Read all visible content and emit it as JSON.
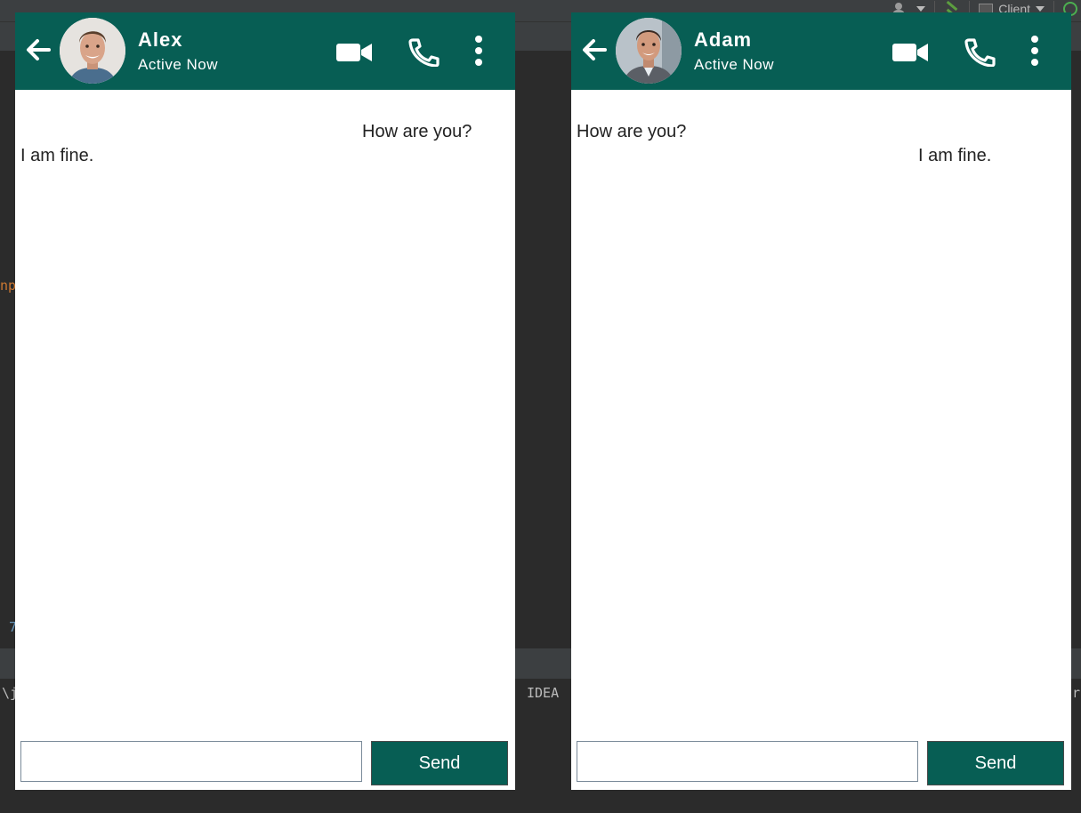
{
  "ide": {
    "client_label": "Client",
    "code_fragment_1": "np'",
    "code_fragment_2": "7",
    "console_left": "\\j",
    "console_mid": "IDEA",
    "console_right": "ra"
  },
  "left_chat": {
    "contact_name": "Alex",
    "status": "Active Now",
    "messages": [
      {
        "text": "How are you?",
        "align": "right"
      },
      {
        "text": "I am fine.",
        "align": "left"
      }
    ],
    "input_value": "",
    "send_label": "Send"
  },
  "right_chat": {
    "contact_name": "Adam",
    "status": "Active Now",
    "messages": [
      {
        "text": "How are you?",
        "align": "left"
      },
      {
        "text": "I am fine.",
        "align": "right"
      }
    ],
    "input_value": "",
    "send_label": "Send"
  },
  "colors": {
    "header": "#075e54",
    "ide_bg": "#2b2b2b"
  },
  "icons": [
    "back-arrow-icon",
    "video-camera-icon",
    "phone-icon",
    "more-vertical-icon",
    "avatar-photo"
  ]
}
